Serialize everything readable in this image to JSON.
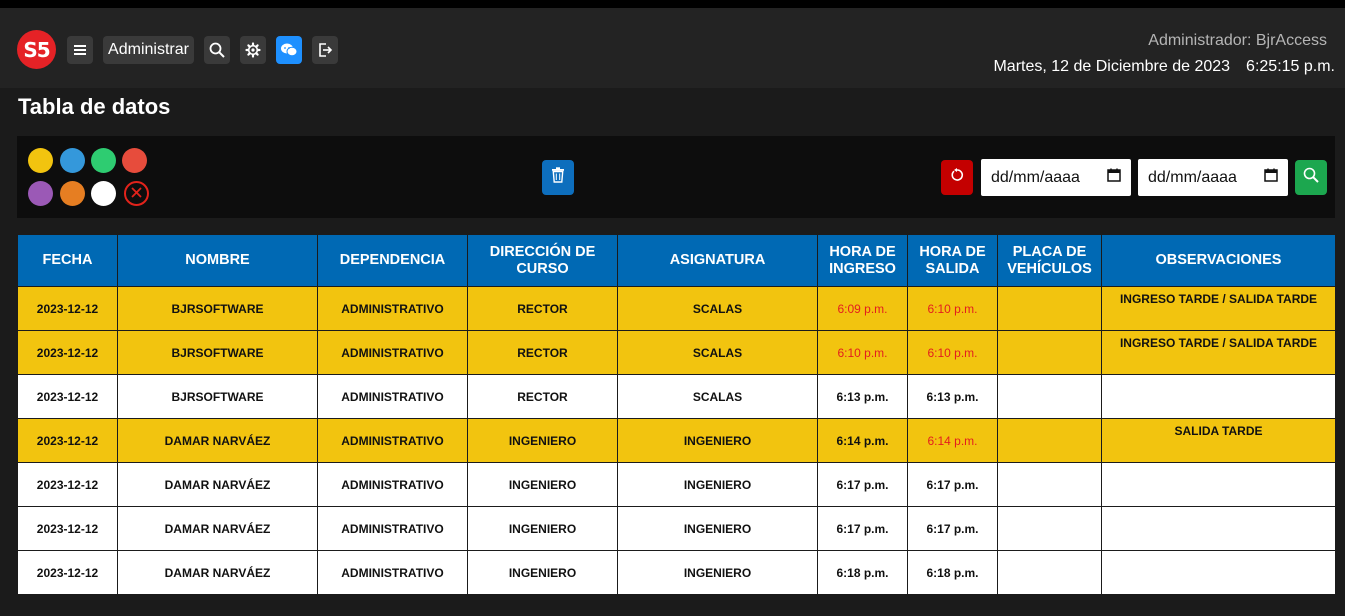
{
  "header": {
    "logo_text": "S5",
    "admin_menu_label": "Administrar",
    "admin_user": "Administrador: BjrAccess",
    "date": "Martes, 12 de Diciembre de 2023",
    "time": "6:25:15 p.m.",
    "icons": [
      "menu-icon",
      "search-icon",
      "gear-icon",
      "chat-icon",
      "logout-icon"
    ]
  },
  "page_title": "Tabla de datos",
  "toolbar": {
    "color_filters": [
      "#f2c40f",
      "#3498db",
      "#2ecc71",
      "#e74c3c",
      "#9b59b6",
      "#e67e22",
      "#ffffff"
    ],
    "date_from_placeholder": "dd/mm/aaaa",
    "date_to_placeholder": "dd/mm/aaaa"
  },
  "colors": {
    "header_blue": "#0069b4",
    "row_yellow": "#f2c40f",
    "late_red": "#e31e1e",
    "delete_blue": "#0d6ebd",
    "reset_red": "#c40000",
    "search_green": "#1ca74f"
  },
  "table": {
    "headers": [
      "FECHA",
      "NOMBRE",
      "DEPENDENCIA",
      "DIRECCIÓN DE CURSO",
      "ASIGNATURA",
      "HORA DE INGRESO",
      "HORA DE SALIDA",
      "PLACA DE VEHÍCULOS",
      "OBSERVACIONES"
    ],
    "rows": [
      {
        "fecha": "2023-12-12",
        "nombre": "BJRSOFTWARE",
        "dependencia": "ADMINISTRATIVO",
        "direccion": "RECTOR",
        "asignatura": "SCALAS",
        "ingreso": "6:09 p.m.",
        "salida": "6:10 p.m.",
        "placa": "",
        "observaciones": "INGRESO TARDE / SALIDA TARDE",
        "highlight": "yellow",
        "ingreso_late": true,
        "salida_late": true
      },
      {
        "fecha": "2023-12-12",
        "nombre": "BJRSOFTWARE",
        "dependencia": "ADMINISTRATIVO",
        "direccion": "RECTOR",
        "asignatura": "SCALAS",
        "ingreso": "6:10 p.m.",
        "salida": "6:10 p.m.",
        "placa": "",
        "observaciones": "INGRESO TARDE / SALIDA TARDE",
        "highlight": "yellow",
        "ingreso_late": true,
        "salida_late": true
      },
      {
        "fecha": "2023-12-12",
        "nombre": "BJRSOFTWARE",
        "dependencia": "ADMINISTRATIVO",
        "direccion": "RECTOR",
        "asignatura": "SCALAS",
        "ingreso": "6:13 p.m.",
        "salida": "6:13 p.m.",
        "placa": "",
        "observaciones": "",
        "highlight": "white",
        "ingreso_late": false,
        "salida_late": false
      },
      {
        "fecha": "2023-12-12",
        "nombre": "DAMAR NARVÁEZ",
        "dependencia": "ADMINISTRATIVO",
        "direccion": "INGENIERO",
        "asignatura": "INGENIERO",
        "ingreso": "6:14 p.m.",
        "salida": "6:14 p.m.",
        "placa": "",
        "observaciones": "SALIDA TARDE",
        "highlight": "yellow",
        "ingreso_late": false,
        "salida_late": true
      },
      {
        "fecha": "2023-12-12",
        "nombre": "DAMAR NARVÁEZ",
        "dependencia": "ADMINISTRATIVO",
        "direccion": "INGENIERO",
        "asignatura": "INGENIERO",
        "ingreso": "6:17 p.m.",
        "salida": "6:17 p.m.",
        "placa": "",
        "observaciones": "",
        "highlight": "white",
        "ingreso_late": false,
        "salida_late": false
      },
      {
        "fecha": "2023-12-12",
        "nombre": "DAMAR NARVÁEZ",
        "dependencia": "ADMINISTRATIVO",
        "direccion": "INGENIERO",
        "asignatura": "INGENIERO",
        "ingreso": "6:17 p.m.",
        "salida": "6:17 p.m.",
        "placa": "",
        "observaciones": "",
        "highlight": "white",
        "ingreso_late": false,
        "salida_late": false
      },
      {
        "fecha": "2023-12-12",
        "nombre": "DAMAR NARVÁEZ",
        "dependencia": "ADMINISTRATIVO",
        "direccion": "INGENIERO",
        "asignatura": "INGENIERO",
        "ingreso": "6:18 p.m.",
        "salida": "6:18 p.m.",
        "placa": "",
        "observaciones": "",
        "highlight": "white",
        "ingreso_late": false,
        "salida_late": false
      }
    ]
  }
}
